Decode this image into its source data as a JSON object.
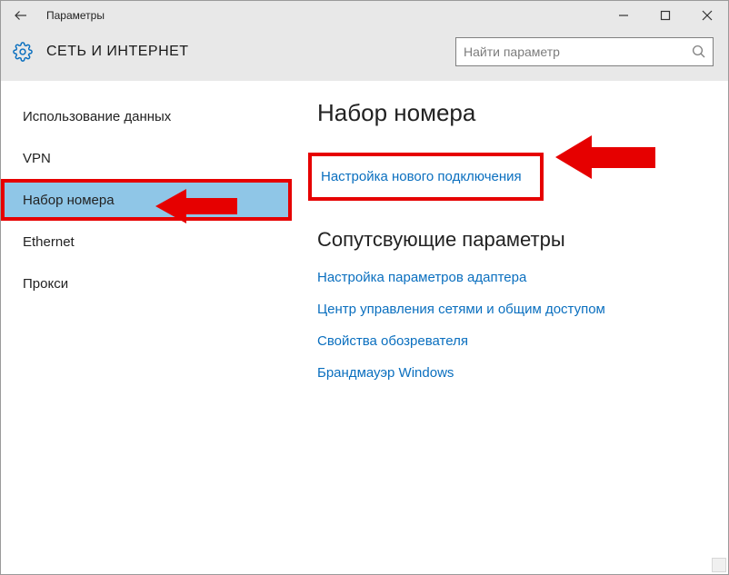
{
  "window": {
    "title": "Параметры"
  },
  "header": {
    "heading": "СЕТЬ И ИНТЕРНЕТ"
  },
  "search": {
    "placeholder": "Найти параметр"
  },
  "sidebar": {
    "items": [
      {
        "label": "Использование данных"
      },
      {
        "label": "VPN"
      },
      {
        "label": "Набор номера"
      },
      {
        "label": "Ethernet"
      },
      {
        "label": "Прокси"
      }
    ]
  },
  "main": {
    "title": "Набор номера",
    "primary_link": "Настройка нового подключения",
    "related_heading": "Сопутсвующие параметры",
    "related_links": [
      "Настройка параметров адаптера",
      "Центр управления сетями и общим доступом",
      "Свойства обозревателя",
      "Брандмауэр Windows"
    ]
  },
  "colors": {
    "accent": "#0a6fbf",
    "annotation": "#e60000",
    "selection": "#8fc6e7"
  }
}
